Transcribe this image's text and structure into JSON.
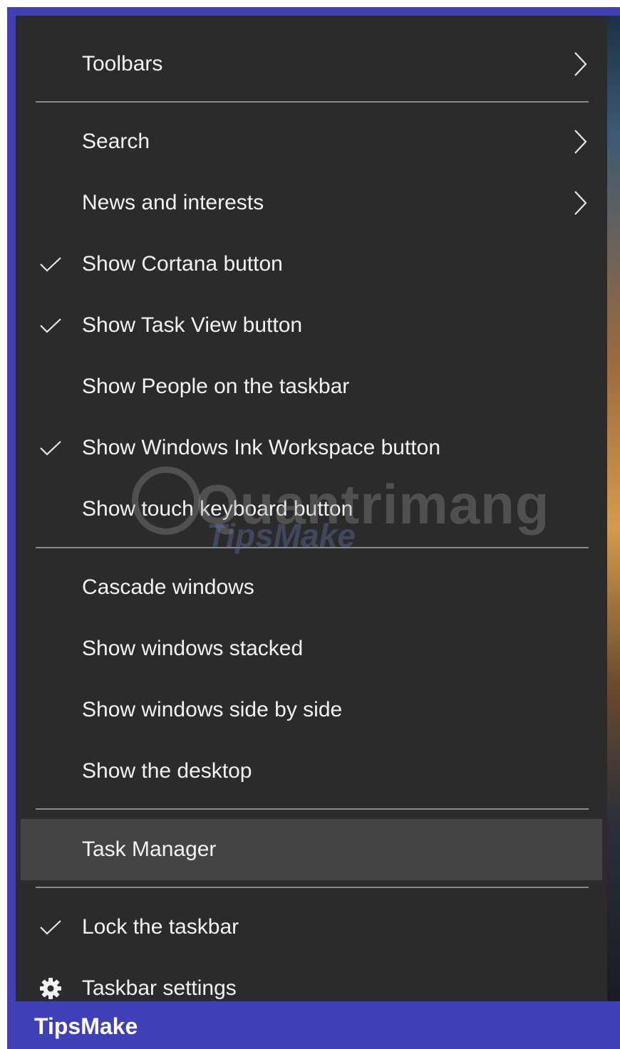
{
  "menu": {
    "items": [
      {
        "label": "Toolbars",
        "submenu": true,
        "checked": false
      },
      {
        "label": "Search",
        "submenu": true,
        "checked": false
      },
      {
        "label": "News and interests",
        "submenu": true,
        "checked": false
      },
      {
        "label": "Show Cortana button",
        "submenu": false,
        "checked": true
      },
      {
        "label": "Show Task View button",
        "submenu": false,
        "checked": true
      },
      {
        "label": "Show People on the taskbar",
        "submenu": false,
        "checked": false
      },
      {
        "label": "Show Windows Ink Workspace button",
        "submenu": false,
        "checked": true
      },
      {
        "label": "Show touch keyboard button",
        "submenu": false,
        "checked": false
      },
      {
        "label": "Cascade windows",
        "submenu": false,
        "checked": false
      },
      {
        "label": "Show windows stacked",
        "submenu": false,
        "checked": false
      },
      {
        "label": "Show windows side by side",
        "submenu": false,
        "checked": false
      },
      {
        "label": "Show the desktop",
        "submenu": false,
        "checked": false
      },
      {
        "label": "Task Manager",
        "submenu": false,
        "checked": false,
        "highlighted": true
      },
      {
        "label": "Lock the taskbar",
        "submenu": false,
        "checked": true
      },
      {
        "label": "Taskbar settings",
        "submenu": false,
        "checked": false,
        "icon": "gear-icon"
      }
    ]
  },
  "watermark": {
    "main": "Quantrimang",
    "sub": "TipsMake"
  },
  "footer": {
    "brand": "TipsMake"
  },
  "colors": {
    "menu_background": "#2b2b2b",
    "highlight": "#444444",
    "text": "#f2f2f2",
    "separator": "#8a8a8a",
    "frame": "#3f3fb8"
  }
}
